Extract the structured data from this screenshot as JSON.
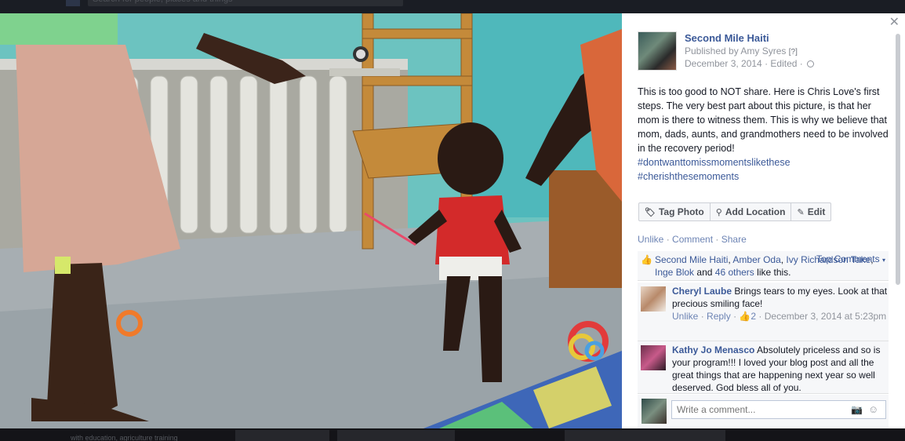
{
  "background": {
    "search_placeholder": "Search for people, places and things",
    "bottom_text": "with education, agriculture training"
  },
  "post": {
    "page_name": "Second Mile Haiti",
    "published_by": "Published by Amy Syres",
    "published_badge": "[?]",
    "date": "December 3, 2014",
    "edited": "Edited",
    "text": "This is too good to NOT share. Here is Chris Love's first steps. The very best part about this picture, is that her mom is there to witness them. This is why we believe that mom, dads, aunts, and grandmothers need to be involved in the recovery period!",
    "hashtags": [
      "#dontwanttomissmomentslikethese",
      "#cherishthesemoments"
    ]
  },
  "actions": {
    "tag_photo": "Tag Photo",
    "add_location": "Add Location",
    "edit": "Edit"
  },
  "ufi": {
    "unlike": "Unlike",
    "comment": "Comment",
    "share": "Share",
    "likers": [
      "Second Mile Haiti",
      "Amber Oda",
      "Ivy Richardson Take",
      "Inge Blok"
    ],
    "and_word": "and",
    "others": "46 others",
    "like_this": "like this.",
    "top_comments": "Top Comments"
  },
  "comments": [
    {
      "author": "Cheryl Laube",
      "text": "Brings tears to my eyes. Look at that precious smiling face!",
      "unlike": "Unlike",
      "reply": "Reply",
      "likes": "2",
      "timestamp": "December 3, 2014 at 5:23pm"
    },
    {
      "author": "Kathy Jo Menasco",
      "text": "Absolutely priceless and so is your program!!! I loved your blog post and all the great things that are happening next year so well deserved. God bless all of you."
    }
  ],
  "composer": {
    "placeholder": "Write a comment..."
  },
  "icons": {
    "close": "close-icon",
    "tag": "tag-icon",
    "location": "location-pin-icon",
    "edit": "pencil-icon",
    "like": "thumbs-up-icon",
    "camera": "camera-icon",
    "emoji": "emoji-icon",
    "privacy": "globe-icon"
  },
  "colors": {
    "link": "#3b5998",
    "muted": "#90949c",
    "panel_bg": "#ffffff",
    "wall": "#6fc2bf"
  }
}
